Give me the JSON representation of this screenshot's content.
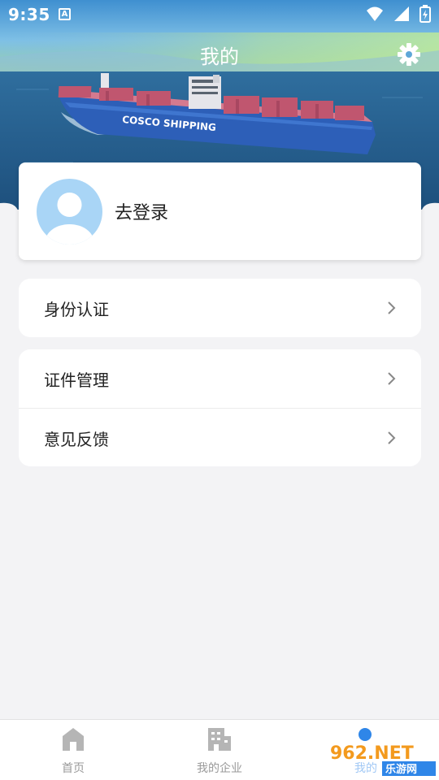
{
  "status_bar": {
    "time": "9:35",
    "notification_glyph": "A",
    "icons": [
      "wifi-icon",
      "cell-signal-icon",
      "battery-charging-icon"
    ]
  },
  "header": {
    "title": "我的",
    "settings_icon": "gear-icon",
    "banner_ship_text": "COSCO SHIPPING"
  },
  "profile": {
    "login_label": "去登录",
    "avatar_icon": "default-avatar-icon"
  },
  "menu_groups": [
    {
      "items": [
        {
          "label": "身份认证"
        }
      ]
    },
    {
      "items": [
        {
          "label": "证件管理"
        },
        {
          "label": "意见反馈"
        }
      ]
    }
  ],
  "bottom_nav": {
    "items": [
      {
        "label": "首页",
        "icon": "home-icon",
        "active": false
      },
      {
        "label": "我的企业",
        "icon": "building-icon",
        "active": false
      },
      {
        "label": "我的",
        "icon": "person-icon",
        "active": true
      }
    ]
  },
  "watermark": {
    "brand": "962.NET",
    "sub": "乐游网"
  },
  "colors": {
    "accent": "#2f86e8",
    "page_bg": "#f3f3f5",
    "avatar_bg": "#a9d5f6",
    "ship_deck": "#c0566f",
    "ship_hull": "#2d5fb8"
  }
}
